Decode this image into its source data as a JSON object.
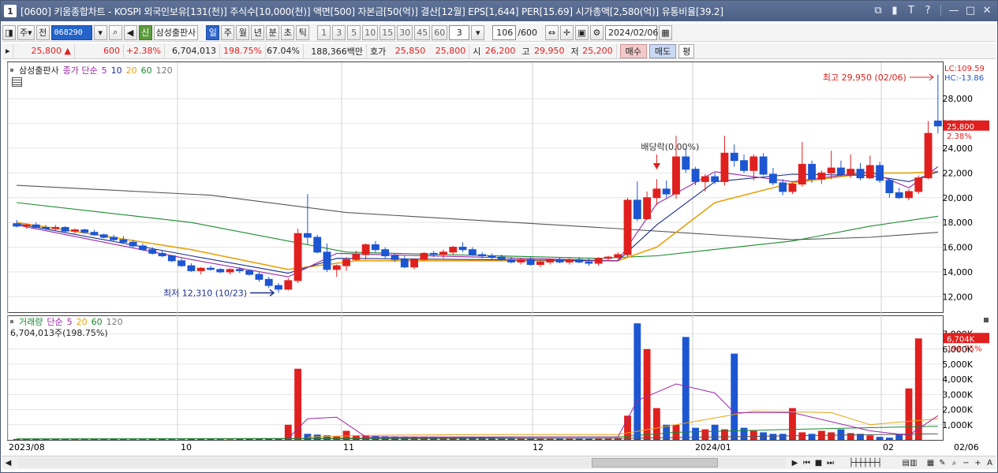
{
  "window": {
    "number": "1",
    "title": "[0600] 키움종합차트 - KOSPI 외국인보유[131(천)] 주식수[10,000(천)] 액면[500] 자본금[50(억)] 결산[12월] EPS[1,644] PER[15.69] 시가총액[2,580(억)] 유통비율[39.2]"
  },
  "toolbar": {
    "period_type": "주",
    "prefix": "전",
    "stock_code": "068290",
    "stock_badge": "신",
    "stock_name": "삼성출판사",
    "timeframes": [
      "일",
      "주",
      "월",
      "년",
      "분",
      "초",
      "틱"
    ],
    "selected_timeframe": "일",
    "intervals": [
      "1",
      "3",
      "5",
      "10",
      "15",
      "30",
      "45",
      "60"
    ],
    "interval_value": "3",
    "count_display": "106",
    "count_total": "/600",
    "date": "2024/02/06"
  },
  "quote": {
    "price": "25,800",
    "change": "600",
    "change_pct": "+2.38%",
    "volume": "6,704,013",
    "volume_ratio": "198.75%",
    "turnover": "67.04%",
    "trade_value": "188,366백만",
    "bid_label": "호가",
    "bid1": "25,850",
    "bid2": "25,800",
    "open_label": "시",
    "open": "26,200",
    "high_label": "고",
    "high": "29,950",
    "low_label": "저",
    "low": "25,200",
    "sell_btn": "매수",
    "buy_btn": "매도",
    "balance_btn": "평"
  },
  "price_legend": {
    "name": "삼성출판사",
    "ma_title": "종가 단순",
    "ma_periods": [
      "5",
      "10",
      "20",
      "60",
      "120"
    ]
  },
  "volume_legend": {
    "name": "거래량",
    "ma_title": "단순",
    "ma_periods": [
      "5",
      "20",
      "60",
      "120"
    ],
    "current": "6,704,013주(198.75%)"
  },
  "annotations": {
    "high_text": "최고 29,950 (02/06)",
    "low_text": "최저 12,310 (10/23)",
    "dividend_text": "배당락(0.00%)",
    "lc": "LC:109.59",
    "hc": "HC:-13.86",
    "price_tag": "25,800",
    "price_pct": "2.38%",
    "vol_tag": "6,704K",
    "vol_pct": "198.75%"
  },
  "colors": {
    "up": "#e0201e",
    "down": "#1d56d2",
    "ma5": "#9a27a6",
    "ma10": "#1b2e8f",
    "ma20": "#e8a20c",
    "ma60": "#1a8a2e",
    "ma120": "#555555"
  },
  "chart_data": {
    "type": "candlestick",
    "x_labels": [
      "2023/08",
      "10",
      "11",
      "12",
      "2024/01",
      "02",
      "02/06"
    ],
    "y_ticks": [
      "28,000",
      "26,000",
      "24,000",
      "22,000",
      "20,000",
      "18,000",
      "16,000",
      "14,000",
      "12,000"
    ],
    "ylim": [
      11000,
      30500
    ],
    "vol_ticks": [
      "7,000K",
      "6,000K",
      "5,000K",
      "4,000K",
      "3,000K",
      "2,000K",
      "1,000K"
    ],
    "vol_ylim": [
      0,
      7500
    ],
    "candles": [
      [
        17900,
        18200,
        17600,
        17700
      ],
      [
        17700,
        17900,
        17500,
        17800
      ],
      [
        17800,
        18000,
        17500,
        17600
      ],
      [
        17600,
        17800,
        17400,
        17500
      ],
      [
        17500,
        17800,
        17300,
        17600
      ],
      [
        17600,
        17700,
        17200,
        17300
      ],
      [
        17300,
        17500,
        17100,
        17400
      ],
      [
        17400,
        17500,
        17100,
        17200
      ],
      [
        17200,
        17400,
        16900,
        17000
      ],
      [
        17000,
        17100,
        16700,
        16800
      ],
      [
        16800,
        17000,
        16500,
        16600
      ],
      [
        16600,
        16900,
        16300,
        16400
      ],
      [
        16400,
        16600,
        16000,
        16100
      ],
      [
        16100,
        16300,
        15700,
        15800
      ],
      [
        15800,
        16000,
        15400,
        15500
      ],
      [
        15500,
        15700,
        15200,
        15300
      ],
      [
        15300,
        15400,
        14800,
        14900
      ],
      [
        14900,
        15100,
        14400,
        14500
      ],
      [
        14500,
        14700,
        14000,
        14100
      ],
      [
        14100,
        14400,
        13800,
        14300
      ],
      [
        14300,
        14500,
        14100,
        14200
      ],
      [
        14200,
        14300,
        13900,
        14000
      ],
      [
        14000,
        14300,
        13800,
        14200
      ],
      [
        14200,
        14400,
        13900,
        14100
      ],
      [
        14100,
        14200,
        13700,
        13800
      ],
      [
        13800,
        14000,
        13200,
        13400
      ],
      [
        13400,
        13600,
        12700,
        12900
      ],
      [
        12900,
        13100,
        12310,
        12600
      ],
      [
        12600,
        13500,
        12500,
        13300
      ],
      [
        13300,
        17500,
        13100,
        17100
      ],
      [
        17100,
        20300,
        16200,
        16800
      ],
      [
        16800,
        17000,
        15500,
        15600
      ],
      [
        15600,
        16300,
        14000,
        14200
      ],
      [
        14200,
        14600,
        13600,
        14500
      ],
      [
        14500,
        15200,
        14100,
        15000
      ],
      [
        15000,
        15700,
        14900,
        15400
      ],
      [
        15400,
        16300,
        15000,
        16200
      ],
      [
        16200,
        16500,
        15600,
        15800
      ],
      [
        15800,
        16000,
        15100,
        15300
      ],
      [
        15300,
        15500,
        14800,
        15000
      ],
      [
        15000,
        15300,
        14300,
        14400
      ],
      [
        14400,
        15100,
        14200,
        15000
      ],
      [
        15000,
        15600,
        14900,
        15500
      ],
      [
        15500,
        15700,
        15200,
        15400
      ],
      [
        15400,
        15800,
        15100,
        15600
      ],
      [
        15600,
        16100,
        15400,
        16000
      ],
      [
        16000,
        16400,
        15600,
        15800
      ],
      [
        15800,
        16000,
        15300,
        15400
      ],
      [
        15400,
        15600,
        15100,
        15300
      ],
      [
        15300,
        15500,
        15000,
        15200
      ],
      [
        15200,
        15400,
        14900,
        15000
      ],
      [
        15000,
        15200,
        14700,
        14800
      ],
      [
        14800,
        15100,
        14600,
        15000
      ],
      [
        15000,
        15200,
        14500,
        14600
      ],
      [
        14600,
        14900,
        14400,
        14800
      ],
      [
        14800,
        15100,
        14600,
        15000
      ],
      [
        15000,
        15200,
        14700,
        14800
      ],
      [
        14800,
        15100,
        14600,
        15000
      ],
      [
        15000,
        15200,
        14700,
        14800
      ],
      [
        14800,
        15100,
        14500,
        14700
      ],
      [
        14700,
        15200,
        14500,
        15100
      ],
      [
        15100,
        15300,
        14900,
        15200
      ],
      [
        15200,
        15600,
        15000,
        15400
      ],
      [
        15400,
        20000,
        15200,
        19800
      ],
      [
        19800,
        21300,
        18100,
        18300
      ],
      [
        18300,
        20500,
        18200,
        20000
      ],
      [
        20000,
        21500,
        19400,
        20700
      ],
      [
        20700,
        21400,
        20000,
        20300
      ],
      [
        20300,
        25000,
        19900,
        23300
      ],
      [
        23300,
        24000,
        22000,
        22300
      ],
      [
        22300,
        22500,
        21000,
        21300
      ],
      [
        21300,
        21900,
        20500,
        21700
      ],
      [
        21700,
        22000,
        21100,
        21300
      ],
      [
        21300,
        25000,
        21000,
        23600
      ],
      [
        23600,
        24300,
        22500,
        23000
      ],
      [
        23000,
        23500,
        22000,
        22200
      ],
      [
        22200,
        23500,
        21400,
        23300
      ],
      [
        23300,
        23600,
        21800,
        21900
      ],
      [
        21900,
        22400,
        21000,
        21200
      ],
      [
        21200,
        21500,
        20200,
        20500
      ],
      [
        20500,
        21200,
        20300,
        21100
      ],
      [
        21100,
        24500,
        20900,
        22700
      ],
      [
        22700,
        23000,
        21200,
        21500
      ],
      [
        21500,
        22200,
        21100,
        22000
      ],
      [
        22000,
        23800,
        21500,
        22400
      ],
      [
        22400,
        23000,
        21700,
        21900
      ],
      [
        21900,
        23500,
        21600,
        22300
      ],
      [
        22300,
        22800,
        21400,
        21600
      ],
      [
        21600,
        23400,
        21500,
        22600
      ],
      [
        22600,
        22900,
        21200,
        21400
      ],
      [
        21400,
        21600,
        20000,
        20400
      ],
      [
        20400,
        20800,
        19900,
        20000
      ],
      [
        20000,
        20700,
        19800,
        20500
      ],
      [
        20500,
        21800,
        20300,
        21600
      ],
      [
        21600,
        26200,
        21500,
        25200
      ],
      [
        26200,
        29950,
        25200,
        25800
      ]
    ],
    "volumes": [
      60,
      55,
      50,
      45,
      50,
      40,
      45,
      40,
      50,
      45,
      50,
      45,
      40,
      45,
      55,
      50,
      45,
      40,
      60,
      55,
      50,
      45,
      40,
      50,
      55,
      60,
      65,
      70,
      1000,
      4700,
      400,
      350,
      300,
      250,
      600,
      300,
      280,
      260,
      240,
      220,
      210,
      200,
      190,
      180,
      170,
      160,
      150,
      140,
      130,
      130,
      120,
      120,
      110,
      110,
      100,
      100,
      110,
      100,
      110,
      105,
      120,
      130,
      140,
      1600,
      7700,
      6000,
      2100,
      1000,
      1000,
      6800,
      800,
      700,
      1000,
      700,
      5700,
      800,
      600,
      500,
      400,
      400,
      2100,
      500,
      400,
      600,
      500,
      700,
      450,
      400,
      300,
      200,
      150,
      400,
      3400,
      6704
    ],
    "ma_price": {
      "ma5": [
        [
          0,
          17800
        ],
        [
          18,
          15000
        ],
        [
          28,
          13600
        ],
        [
          33,
          15500
        ],
        [
          62,
          14900
        ],
        [
          66,
          19500
        ],
        [
          72,
          22100
        ],
        [
          80,
          21300
        ],
        [
          88,
          22100
        ],
        [
          92,
          20800
        ],
        [
          95,
          22500
        ]
      ],
      "ma10": [
        [
          0,
          17900
        ],
        [
          18,
          15300
        ],
        [
          28,
          13900
        ],
        [
          33,
          15100
        ],
        [
          62,
          14900
        ],
        [
          66,
          17800
        ],
        [
          72,
          21300
        ],
        [
          80,
          21900
        ],
        [
          88,
          21800
        ],
        [
          92,
          21300
        ],
        [
          95,
          22100
        ]
      ],
      "ma20": [
        [
          0,
          18000
        ],
        [
          18,
          15800
        ],
        [
          28,
          14200
        ],
        [
          35,
          14900
        ],
        [
          62,
          14900
        ],
        [
          66,
          16000
        ],
        [
          72,
          19600
        ],
        [
          80,
          21200
        ],
        [
          88,
          22000
        ],
        [
          92,
          22000
        ],
        [
          95,
          22100
        ]
      ],
      "ma60": [
        [
          0,
          19600
        ],
        [
          18,
          18000
        ],
        [
          34,
          15600
        ],
        [
          60,
          15100
        ],
        [
          66,
          15300
        ],
        [
          80,
          16500
        ],
        [
          88,
          17700
        ],
        [
          95,
          18500
        ]
      ],
      "ma120": [
        [
          0,
          21000
        ],
        [
          20,
          20200
        ],
        [
          34,
          18800
        ],
        [
          62,
          17500
        ],
        [
          80,
          16600
        ],
        [
          88,
          16800
        ],
        [
          95,
          17200
        ]
      ]
    },
    "ma_volume": {
      "ma5": [
        [
          28,
          100
        ],
        [
          30,
          1400
        ],
        [
          33,
          1500
        ],
        [
          36,
          200
        ],
        [
          62,
          200
        ],
        [
          64,
          2600
        ],
        [
          68,
          3700
        ],
        [
          72,
          3100
        ],
        [
          74,
          1800
        ],
        [
          80,
          1800
        ],
        [
          88,
          600
        ],
        [
          92,
          300
        ],
        [
          95,
          1600
        ]
      ],
      "ma20": [
        [
          30,
          200
        ],
        [
          36,
          300
        ],
        [
          48,
          350
        ],
        [
          62,
          350
        ],
        [
          68,
          1000
        ],
        [
          76,
          1900
        ],
        [
          84,
          1800
        ],
        [
          88,
          1000
        ],
        [
          95,
          1400
        ]
      ],
      "ma60": [
        [
          0,
          60
        ],
        [
          30,
          100
        ],
        [
          62,
          200
        ],
        [
          68,
          500
        ],
        [
          80,
          700
        ],
        [
          95,
          900
        ]
      ],
      "ma120": [
        [
          0,
          60
        ],
        [
          62,
          100
        ],
        [
          72,
          200
        ],
        [
          95,
          400
        ]
      ]
    }
  }
}
